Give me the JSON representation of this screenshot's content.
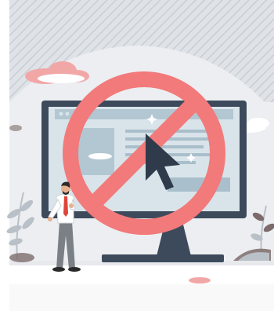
{
  "scene": {
    "subject": "no-clicking-illustration",
    "colors": {
      "hatch_background": "#dfe3e7",
      "hatch_line": "#c9ced4",
      "arc_background": "#eceef1",
      "ground": "#e7e9ec",
      "monitor_frame": "#3d4a5c",
      "screen": "#d9e4ea",
      "screen_header": "#b2c7d2",
      "screen_lines": "#a9bfcb",
      "screen_block": "#b2c7d2",
      "cursor": "#2f3a4a",
      "prohibition_red": "#f27a7a",
      "cloud_pink": "#f2a7a7",
      "cloud_white": "#ffffff",
      "plant_gray": "#b9c0c7",
      "plant_dark": "#7d6b6b",
      "person_shirt": "#ffffff",
      "person_pants": "#7b7f86",
      "person_tie": "#e0453c",
      "person_skin": "#e7b08f",
      "person_hair": "#2a2a2a"
    }
  }
}
